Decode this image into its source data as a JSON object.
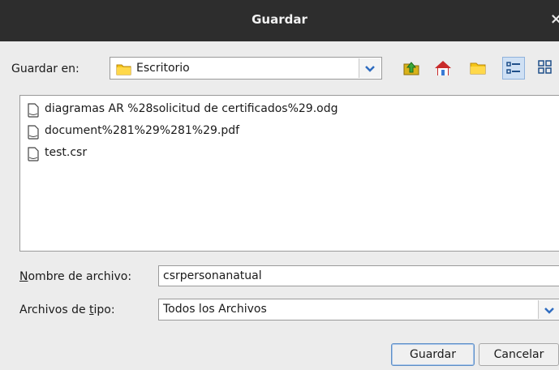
{
  "dialog": {
    "title": "Guardar",
    "close_glyph": "×"
  },
  "location": {
    "label": "Guardar en:",
    "selected": "Escritorio",
    "icon": "folder-icon"
  },
  "toolbar": {
    "buttons": [
      {
        "name": "up-one-level",
        "icon": "up-folder-icon"
      },
      {
        "name": "home",
        "icon": "home-icon"
      },
      {
        "name": "new-folder",
        "icon": "new-folder-icon"
      },
      {
        "name": "list-view",
        "icon": "list-view-icon",
        "active": true
      },
      {
        "name": "details-view",
        "icon": "details-view-icon",
        "active": false
      }
    ]
  },
  "files": [
    {
      "name": "diagramas AR %28solicitud de certificados%29.odg",
      "icon": "file-icon"
    },
    {
      "name": "document%281%29%281%29.pdf",
      "icon": "file-icon"
    },
    {
      "name": "test.csr",
      "icon": "file-icon"
    }
  ],
  "filename": {
    "label_mnemonic": "N",
    "label_rest": "ombre de archivo:",
    "value": "csrpersonanatual"
  },
  "filetype": {
    "label_pre": "Archivos de ",
    "label_mnemonic": "t",
    "label_post": "ipo:",
    "selected": "Todos los Archivos"
  },
  "buttons": {
    "save": "Guardar",
    "cancel": "Cancelar"
  },
  "colors": {
    "accent": "#3a7bd5",
    "folder": "#f5c518",
    "titlebar": "#2d2d2d"
  }
}
